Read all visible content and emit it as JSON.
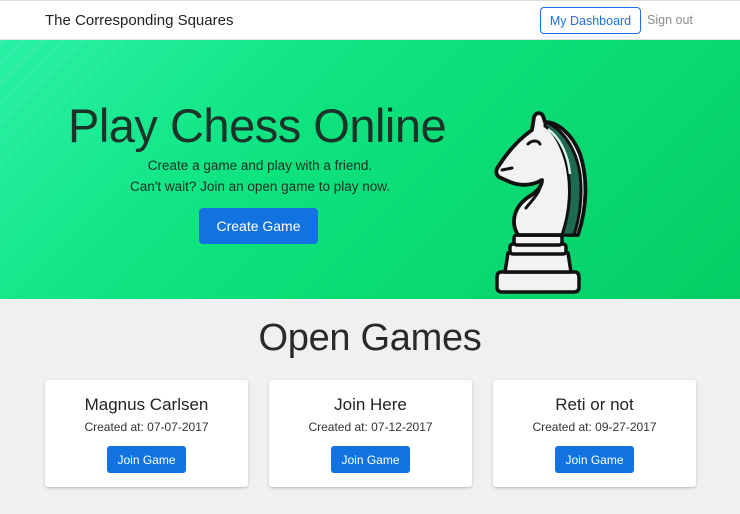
{
  "navbar": {
    "brand": "The Corresponding Squares",
    "dashboard_label": "My Dashboard",
    "signout_label": "Sign out"
  },
  "hero": {
    "title": "Play Chess Online",
    "line1": "Create a game and play with a friend.",
    "line2": "Can't wait? Join an open game to play now.",
    "create_label": "Create Game",
    "illustration": "chess-knight-icon"
  },
  "open_games": {
    "title": "Open Games",
    "created_prefix": "Created at: ",
    "join_label": "Join Game",
    "games": [
      {
        "name": "Magnus Carlsen",
        "created": "Created at: 07-07-2017"
      },
      {
        "name": "Join Here",
        "created": "Created at: 07-12-2017"
      },
      {
        "name": "Reti or not",
        "created": "Created at: 09-27-2017"
      }
    ]
  },
  "colors": {
    "accent": "#1273e0",
    "hero_green": "#0ee37e",
    "page_bg": "#f0f0f0"
  }
}
